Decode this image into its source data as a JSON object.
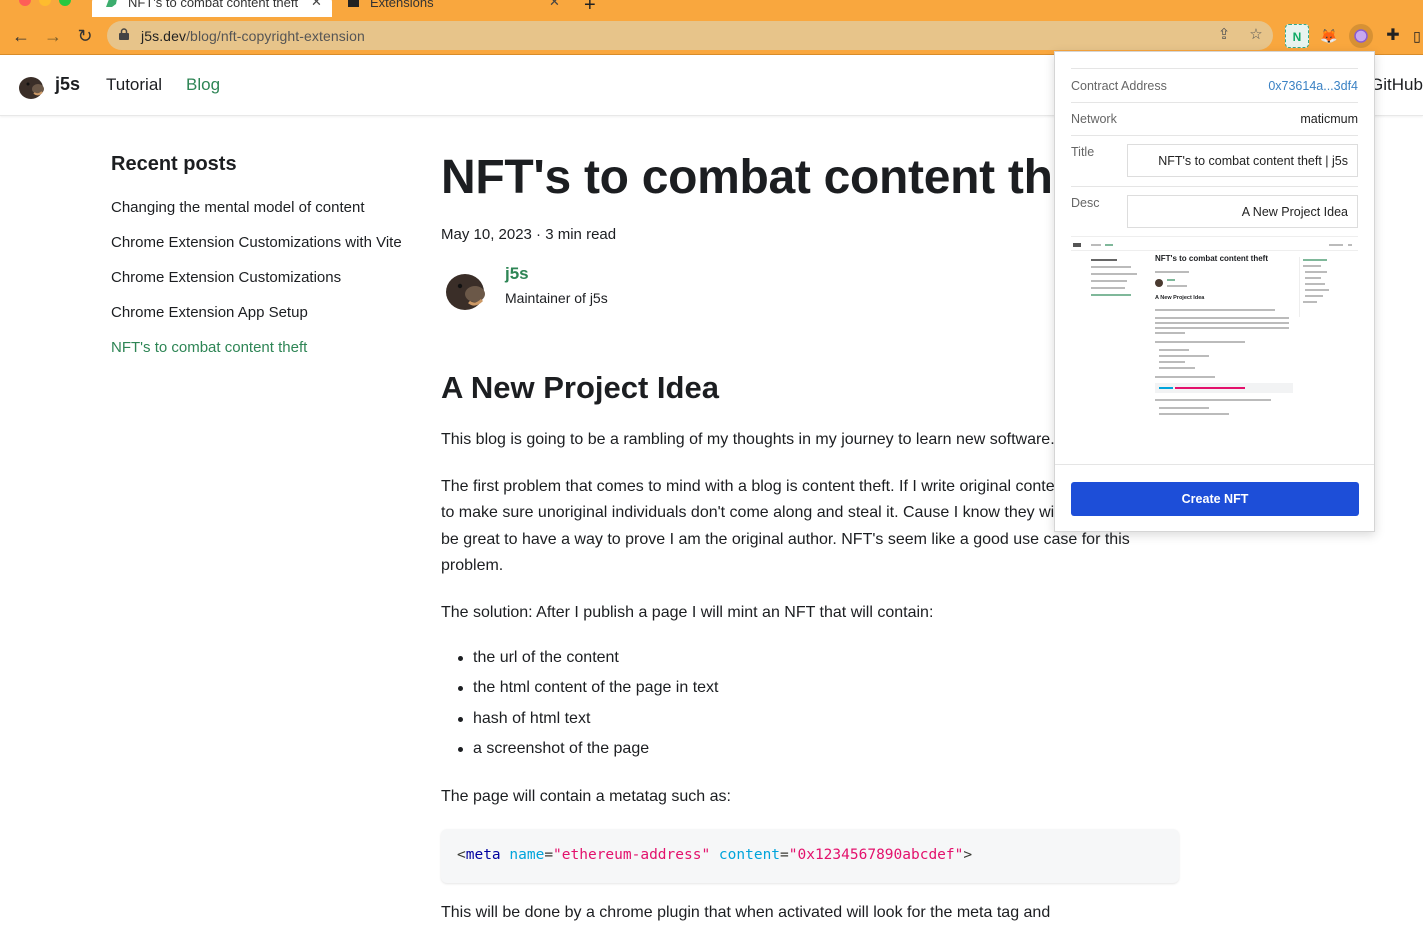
{
  "browser": {
    "tabs": [
      {
        "title": "NFT's to combat content theft"
      },
      {
        "title": "Extensions"
      }
    ],
    "url_host": "j5s.dev",
    "url_path": "/blog/nft-copyright-extension"
  },
  "site": {
    "brand": "j5s",
    "nav": [
      {
        "label": "Tutorial"
      },
      {
        "label": "Blog"
      }
    ],
    "github_label": "GitHub"
  },
  "sidebar": {
    "title": "Recent posts",
    "items": [
      {
        "label": "Changing the mental model of content"
      },
      {
        "label": "Chrome Extension Customizations with Vite"
      },
      {
        "label": "Chrome Extension Customizations"
      },
      {
        "label": "Chrome Extension App Setup"
      },
      {
        "label": "NFT's to combat content theft"
      }
    ]
  },
  "article": {
    "title": "NFT's to combat content theft",
    "meta": "May 10, 2023 · 3 min read",
    "author_name": "j5s",
    "author_title": "Maintainer of j5s",
    "section_title": "A New Project Idea",
    "p1": "This blog is going to be a rambling of my thoughts in my journey to learn new software.",
    "p2": "The first problem that comes to mind with a blog is content theft. If I write original content I want to make sure unoriginal individuals don't come along and steal it. Cause I know they will. It would be great to have a way to prove I am the original author. NFT's seem like a good use case for this problem.",
    "p3": "The solution: After I publish a page I will mint an NFT that will contain:",
    "list": [
      "the url of the content",
      "the html content of the page in text",
      "hash of html text",
      "a screenshot of the page"
    ],
    "p4": "The page will contain a metatag such as:",
    "code": {
      "open": "<",
      "tag": "meta",
      "attr1": "name",
      "eq1": "=",
      "val1": "\"ethereum-address\"",
      "attr2": "content",
      "eq2": "=",
      "val2": "\"0x1234567890abcdef\"",
      "close": ">"
    },
    "p5": "This will be done by a chrome plugin that when activated will look for the meta tag and"
  },
  "popup": {
    "contract_label": "Contract Address",
    "contract_value": "0x73614a...3df4",
    "network_label": "Network",
    "network_value": "maticmum",
    "title_label": "Title",
    "title_value": "NFT's to combat content theft | j5s",
    "desc_label": "Desc",
    "desc_value": "A New Project Idea",
    "preview": {
      "title": "NFT's to combat content theft",
      "section": "A New Project Idea"
    },
    "create_button": "Create NFT"
  },
  "colors": {
    "chrome": "#f9a73e",
    "link_green": "#2e8555",
    "button_blue": "#1d4ed8"
  }
}
